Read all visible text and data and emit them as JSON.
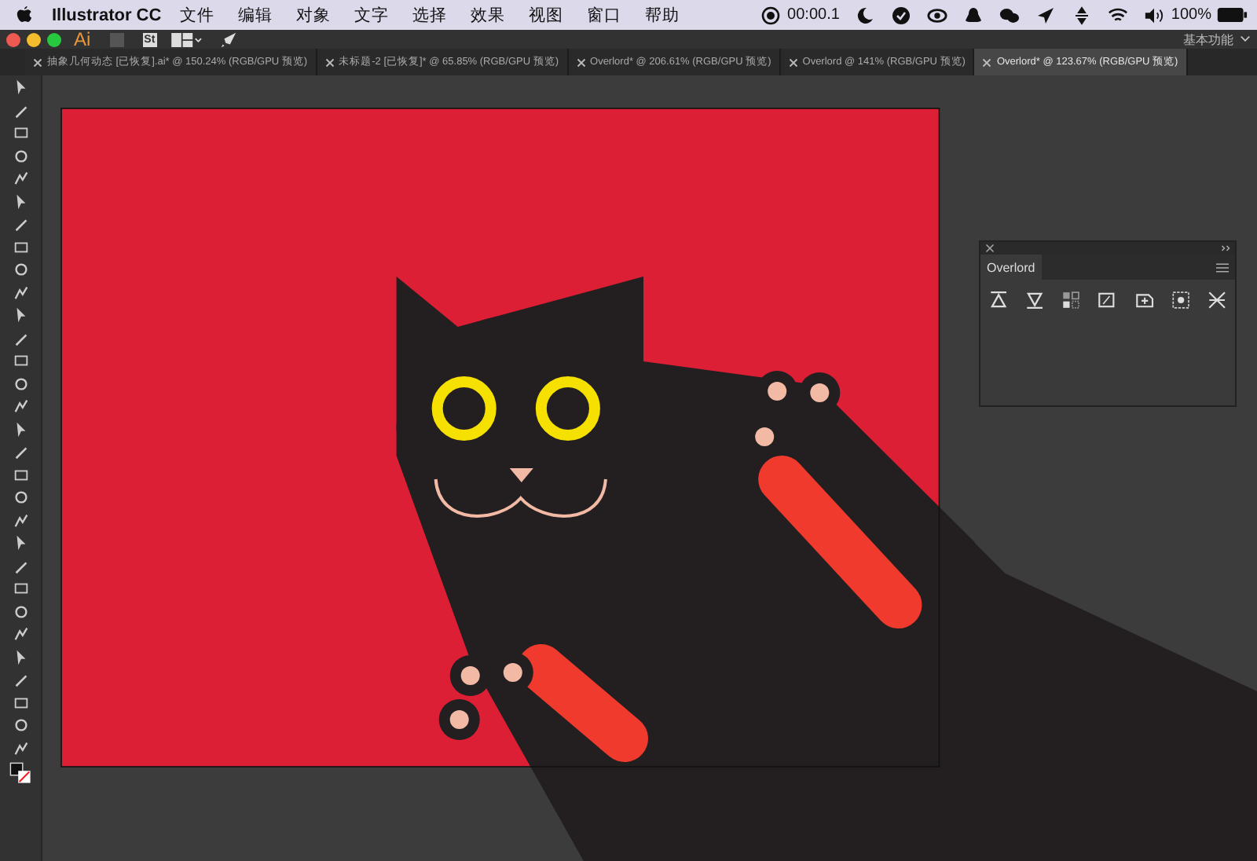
{
  "menu_bar": {
    "app_name": "Illustrator CC",
    "items": [
      "文件",
      "编辑",
      "对象",
      "文字",
      "选择",
      "效果",
      "视图",
      "窗口",
      "帮助"
    ],
    "timer": "00:00.1",
    "battery": "100%"
  },
  "app_bar": {
    "logo": "Ai",
    "bridge": "St",
    "workspace": "基本功能"
  },
  "tabs": [
    {
      "label": "抽象几何动态 [已恢复].ai* @ 150.24% (RGB/GPU 预览)",
      "selected": false
    },
    {
      "label": "未标题-2 [已恢复]* @ 65.85% (RGB/GPU 预览)",
      "selected": false
    },
    {
      "label": "Overlord* @ 206.61% (RGB/GPU 预览)",
      "selected": false
    },
    {
      "label": "Overlord @ 141% (RGB/GPU 预览)",
      "selected": false
    },
    {
      "label": "Overlord* @ 123.67% (RGB/GPU 预览)",
      "selected": true
    }
  ],
  "panel": {
    "tab": "Overlord"
  }
}
